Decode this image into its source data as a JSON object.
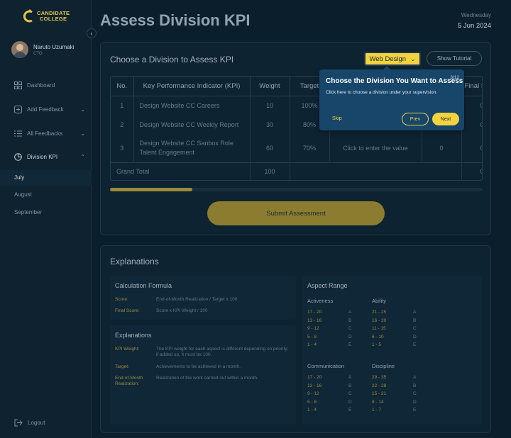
{
  "brand": {
    "line1": "CANDIDATE",
    "line2": "COLLEGE"
  },
  "user": {
    "name": "Naruto Uzumaki",
    "role": "CTO"
  },
  "nav": {
    "dashboard": "Dashboard",
    "add_feedback": "Add Feedback",
    "all_feedbacks": "All Feedbacks",
    "division_kpi": "Division KPI",
    "months": [
      "July",
      "August",
      "September"
    ],
    "logout": "Logout"
  },
  "header": {
    "title": "Assess Division KPI",
    "weekday": "Wednesday",
    "date": "5 Jun 2024"
  },
  "assess": {
    "title": "Choose a Division to Assess KPI",
    "division": "Web Design",
    "tutorial_label": "Show Tutorial",
    "columns": [
      "No.",
      "Key Performance Indicator (KPI)",
      "Weight",
      "Target",
      "",
      "",
      "Final S"
    ],
    "rows": [
      {
        "no": "1",
        "kpi": "Design Website CC Careers",
        "weight": "10",
        "target": "100%",
        "realization": "",
        "score": "",
        "final": "0"
      },
      {
        "no": "2",
        "kpi": "Design Website CC Weekly Report",
        "weight": "30",
        "target": "80%",
        "realization": "",
        "score": "",
        "final": "0"
      },
      {
        "no": "3",
        "kpi": "Design Website CC Sanbox Role Talent Engagement",
        "weight": "60",
        "target": "70%",
        "realization": "Click to enter the value",
        "score": "0",
        "final": "0"
      }
    ],
    "grand_total_label": "Grand Total",
    "grand_total_weight": "100",
    "grand_total_final": "0",
    "scroll_progress": 0.22,
    "submit_label": "Submit Assessment"
  },
  "tooltip": {
    "title": "Choose the Division You Want to Assess",
    "step": "3/12",
    "body": "Click here to choose a division under your supervision.",
    "skip": "Skip",
    "prev": "Prev",
    "next": "Next"
  },
  "explanations": {
    "title": "Explanations",
    "calc": {
      "title": "Calculation Formula",
      "items": [
        {
          "k": "Score:",
          "v": "End-of-Month Realization / Target x 100"
        },
        {
          "k": "Final Score:",
          "v": "Score x KPI Weight / 100"
        }
      ]
    },
    "exp": {
      "title": "Explanations",
      "items": [
        {
          "k": "KPI Weight:",
          "v": "The KPI weight for each aspect is different depending on priority; if added up, it must be 100."
        },
        {
          "k": "Target:",
          "v": "Achievements to be achieved in a month."
        },
        {
          "k": "End-of-Month Realization:",
          "v": "Realization of the work carried out within a month."
        }
      ]
    },
    "aspect": {
      "title": "Aspect Range",
      "groups": [
        {
          "name": "Activeness",
          "ranges": [
            "17 - 20",
            "13 - 16",
            "9 - 12",
            "5 - 8",
            "1 - 4"
          ],
          "grades": [
            "A",
            "B",
            "C",
            "D",
            "E"
          ]
        },
        {
          "name": "Ability",
          "ranges": [
            "21 - 25",
            "16 - 20",
            "11 - 15",
            "6 - 10",
            "1 - 5"
          ],
          "grades": [
            "A",
            "B",
            "C",
            "D",
            "E"
          ]
        },
        {
          "name": "Communication",
          "ranges": [
            "17 - 20",
            "13 - 16",
            "9 - 12",
            "5 - 8",
            "1 - 4"
          ],
          "grades": [
            "A",
            "B",
            "C",
            "D",
            "E"
          ]
        },
        {
          "name": "Discipline",
          "ranges": [
            "29 - 35",
            "22 - 28",
            "15 - 21",
            "8 - 14",
            "1 - 7"
          ],
          "grades": [
            "A",
            "B",
            "C",
            "D",
            "E"
          ]
        }
      ]
    }
  },
  "colors": {
    "accent": "#f2d23e",
    "muted_gold": "#9a8a3c",
    "bg": "#0b1e2b",
    "tooltip": "#17466a"
  }
}
